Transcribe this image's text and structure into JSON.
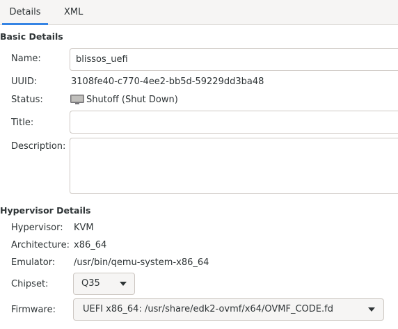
{
  "tabs": [
    {
      "label": "Details"
    },
    {
      "label": "XML"
    }
  ],
  "basic": {
    "title": "Basic Details",
    "name_label": "Name:",
    "name_value": "blissos_uefi",
    "uuid_label": "UUID:",
    "uuid_value": "3108fe40-c770-4ee2-bb5d-59229dd3ba48",
    "status_label": "Status:",
    "status_icon": "monitor-icon",
    "status_value": "Shutoff (Shut Down)",
    "title_label": "Title:",
    "title_value": "",
    "description_label": "Description:",
    "description_value": ""
  },
  "hypervisor": {
    "title": "Hypervisor Details",
    "hypervisor_label": "Hypervisor:",
    "hypervisor_value": "KVM",
    "architecture_label": "Architecture:",
    "architecture_value": "x86_64",
    "emulator_label": "Emulator:",
    "emulator_value": "/usr/bin/qemu-system-x86_64",
    "chipset_label": "Chipset:",
    "chipset_value": "Q35",
    "firmware_label": "Firmware:",
    "firmware_value": "UEFI x86_64: /usr/share/edk2-ovmf/x64/OVMF_CODE.fd"
  },
  "colors": {
    "accent": "#3584e4",
    "border": "#cdc7c2",
    "text": "#2e3436"
  }
}
